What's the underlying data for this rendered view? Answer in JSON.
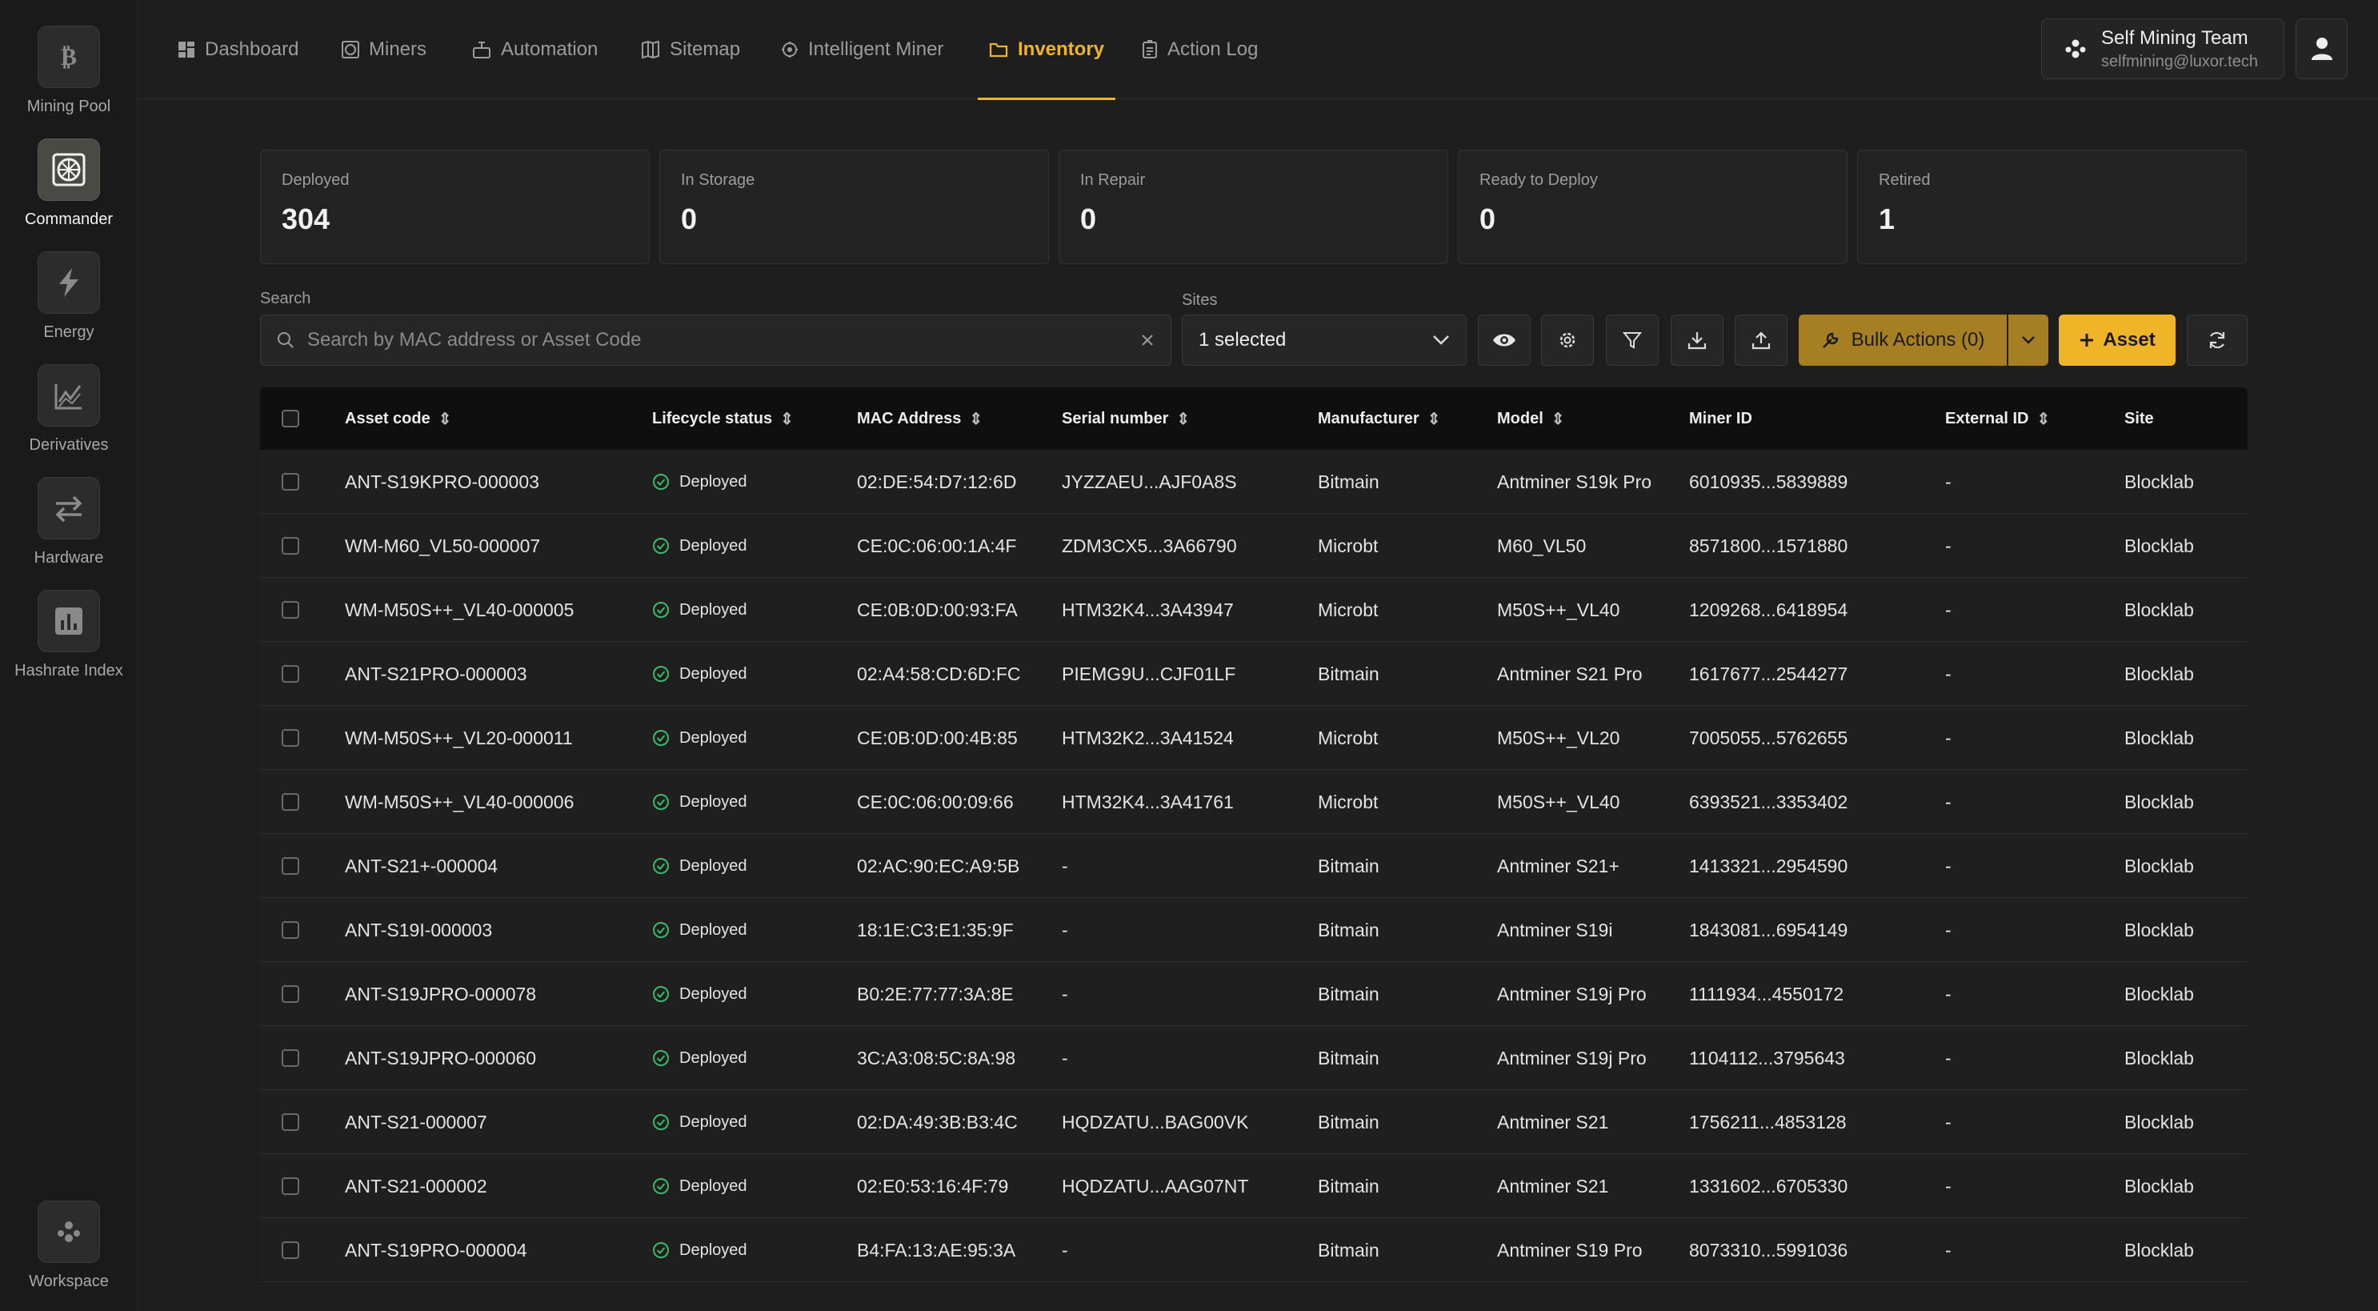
{
  "rail": {
    "items": [
      {
        "label": "Mining Pool",
        "icon": "bitcoin-icon",
        "active": false
      },
      {
        "label": "Commander",
        "icon": "commander-icon",
        "active": true
      },
      {
        "label": "Energy",
        "icon": "lightning-icon",
        "active": false
      },
      {
        "label": "Derivatives",
        "icon": "chart-icon",
        "active": false
      },
      {
        "label": "Hardware",
        "icon": "swap-arrows-icon",
        "active": false
      },
      {
        "label": "Hashrate Index",
        "icon": "bar-chart-icon",
        "active": false
      }
    ],
    "workspace_label": "Workspace"
  },
  "nav": {
    "tabs": [
      {
        "label": "Dashboard",
        "icon": "dashboard-icon"
      },
      {
        "label": "Miners",
        "icon": "miners-icon"
      },
      {
        "label": "Automation",
        "icon": "automation-icon"
      },
      {
        "label": "Sitemap",
        "icon": "sitemap-icon"
      },
      {
        "label": "Intelligent Miner",
        "icon": "intelligent-miner-icon"
      },
      {
        "label": "Inventory",
        "icon": "folder-icon",
        "active": true
      },
      {
        "label": "Action Log",
        "icon": "action-log-icon"
      }
    ],
    "accent_color": "#f0b429"
  },
  "team": {
    "name": "Self Mining Team",
    "email": "selfmining@luxor.tech"
  },
  "stats": [
    {
      "label": "Deployed",
      "value": "304"
    },
    {
      "label": "In Storage",
      "value": "0"
    },
    {
      "label": "In Repair",
      "value": "0"
    },
    {
      "label": "Ready to Deploy",
      "value": "0"
    },
    {
      "label": "Retired",
      "value": "1"
    }
  ],
  "filters": {
    "search_label": "Search",
    "search_placeholder": "Search by MAC address or Asset Code",
    "sites_label": "Sites",
    "sites_value": "1 selected",
    "bulk_actions_label": "Bulk Actions (0)",
    "add_asset_label": "Asset"
  },
  "table": {
    "columns": [
      "Asset code",
      "Lifecycle status",
      "MAC Address",
      "Serial number",
      "Manufacturer",
      "Model",
      "Miner ID",
      "External ID",
      "Site"
    ],
    "rows": [
      [
        "ANT-S19KPRO-000003",
        "Deployed",
        "02:DE:54:D7:12:6D",
        "JYZZAEU...AJF0A8S",
        "Bitmain",
        "Antminer S19k Pro",
        "6010935...5839889",
        "-",
        "Blocklab"
      ],
      [
        "WM-M60_VL50-000007",
        "Deployed",
        "CE:0C:06:00:1A:4F",
        "ZDM3CX5...3A66790",
        "Microbt",
        "M60_VL50",
        "8571800...1571880",
        "-",
        "Blocklab"
      ],
      [
        "WM-M50S++_VL40-000005",
        "Deployed",
        "CE:0B:0D:00:93:FA",
        "HTM32K4...3A43947",
        "Microbt",
        "M50S++_VL40",
        "1209268...6418954",
        "-",
        "Blocklab"
      ],
      [
        "ANT-S21PRO-000003",
        "Deployed",
        "02:A4:58:CD:6D:FC",
        "PIEMG9U...CJF01LF",
        "Bitmain",
        "Antminer S21 Pro",
        "1617677...2544277",
        "-",
        "Blocklab"
      ],
      [
        "WM-M50S++_VL20-000011",
        "Deployed",
        "CE:0B:0D:00:4B:85",
        "HTM32K2...3A41524",
        "Microbt",
        "M50S++_VL20",
        "7005055...5762655",
        "-",
        "Blocklab"
      ],
      [
        "WM-M50S++_VL40-000006",
        "Deployed",
        "CE:0C:06:00:09:66",
        "HTM32K4...3A41761",
        "Microbt",
        "M50S++_VL40",
        "6393521...3353402",
        "-",
        "Blocklab"
      ],
      [
        "ANT-S21+-000004",
        "Deployed",
        "02:AC:90:EC:A9:5B",
        "-",
        "Bitmain",
        "Antminer S21+",
        "1413321...2954590",
        "-",
        "Blocklab"
      ],
      [
        "ANT-S19I-000003",
        "Deployed",
        "18:1E:C3:E1:35:9F",
        "-",
        "Bitmain",
        "Antminer S19i",
        "1843081...6954149",
        "-",
        "Blocklab"
      ],
      [
        "ANT-S19JPRO-000078",
        "Deployed",
        "B0:2E:77:77:3A:8E",
        "-",
        "Bitmain",
        "Antminer S19j Pro",
        "1111934...4550172",
        "-",
        "Blocklab"
      ],
      [
        "ANT-S19JPRO-000060",
        "Deployed",
        "3C:A3:08:5C:8A:98",
        "-",
        "Bitmain",
        "Antminer S19j Pro",
        "1104112...3795643",
        "-",
        "Blocklab"
      ],
      [
        "ANT-S21-000007",
        "Deployed",
        "02:DA:49:3B:B3:4C",
        "HQDZATU...BAG00VK",
        "Bitmain",
        "Antminer S21",
        "1756211...4853128",
        "-",
        "Blocklab"
      ],
      [
        "ANT-S21-000002",
        "Deployed",
        "02:E0:53:16:4F:79",
        "HQDZATU...AAG07NT",
        "Bitmain",
        "Antminer S21",
        "1331602...6705330",
        "-",
        "Blocklab"
      ],
      [
        "ANT-S19PRO-000004",
        "Deployed",
        "B4:FA:13:AE:95:3A",
        "-",
        "Bitmain",
        "Antminer S19 Pro",
        "8073310...5991036",
        "-",
        "Blocklab"
      ]
    ],
    "status_color": "#3fb86b"
  }
}
